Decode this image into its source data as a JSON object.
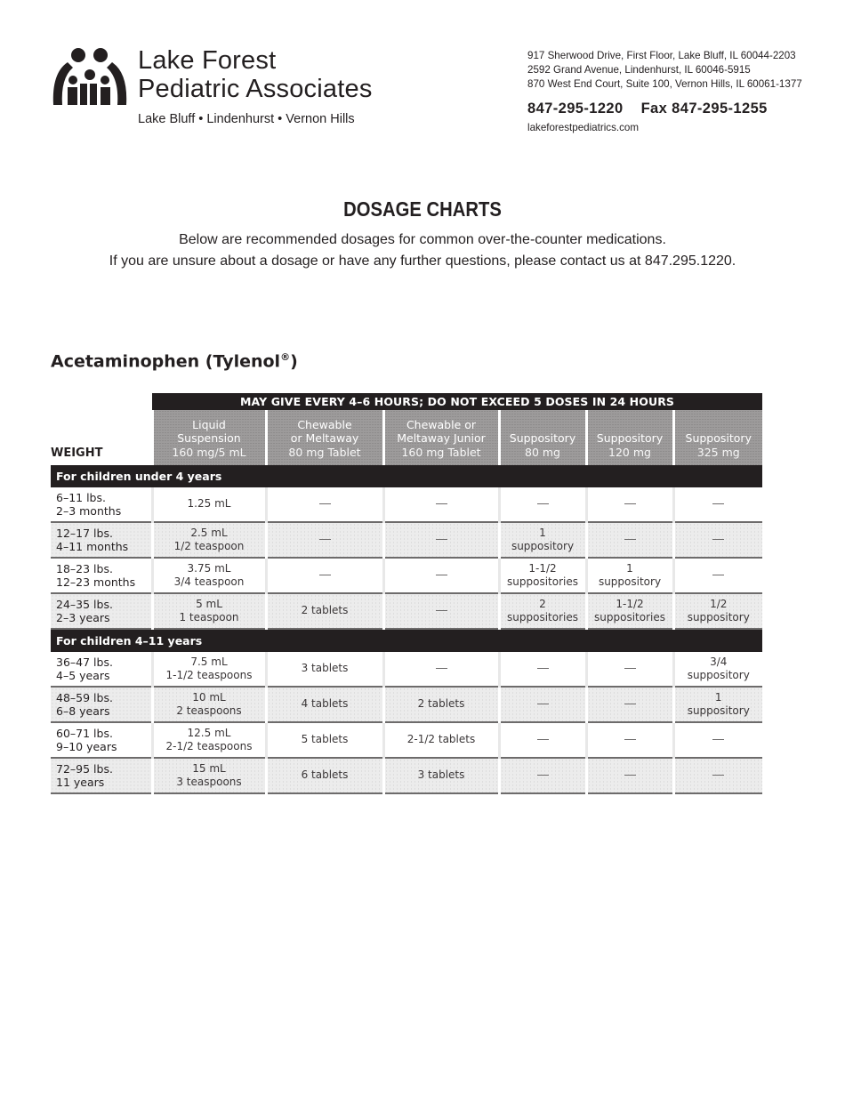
{
  "header": {
    "practice_name_line1": "Lake Forest",
    "practice_name_line2": "Pediatric Associates",
    "locations": "Lake Bluff • Lindenhurst • Vernon Hills",
    "addresses": [
      "917 Sherwood Drive, First Floor, Lake Bluff, IL 60044-2203",
      "2592 Grand Avenue, Lindenhurst, IL 60046-5915",
      "870 West End Court, Suite 100, Vernon Hills, IL 60061-1377"
    ],
    "phone": "847-295-1220",
    "fax": "Fax 847-295-1255",
    "website": "lakeforestpediatrics.com",
    "logo_icon": "family-logo-icon"
  },
  "page": {
    "title": "DOSAGE CHARTS",
    "intro_line1": "Below are recommended dosages for common over-the-counter medications.",
    "intro_line2": "If you are unsure about a dosage or have any further questions, please contact us at 847.295.1220."
  },
  "section": {
    "title": "Acetaminophen (Tylenol",
    "title_reg": "®",
    "title_close": ")"
  },
  "table": {
    "banner": "MAY GIVE EVERY 4–6 HOURS; DO NOT EXCEED 5 DOSES IN 24 HOURS",
    "weight_header": "WEIGHT",
    "columns": [
      {
        "line1": "Liquid",
        "line2": "Suspension",
        "line3": "160 mg/5 mL"
      },
      {
        "line1": "Chewable",
        "line2": "or Meltaway",
        "line3": "80 mg Tablet"
      },
      {
        "line1": "Chewable or",
        "line2": "Meltaway Junior",
        "line3": "160 mg Tablet"
      },
      {
        "line1": "",
        "line2": "Suppository",
        "line3": "80 mg"
      },
      {
        "line1": "",
        "line2": "Suppository",
        "line3": "120 mg"
      },
      {
        "line1": "",
        "line2": "Suppository",
        "line3": "325 mg"
      }
    ],
    "groups": [
      {
        "label": "For children under 4 years",
        "rows": [
          {
            "weight": "6–11 lbs.",
            "age": "2–3 months",
            "cells": [
              [
                "1.25 mL"
              ],
              [
                "—"
              ],
              [
                "—"
              ],
              [
                "—"
              ],
              [
                "—"
              ],
              [
                "—"
              ]
            ]
          },
          {
            "weight": "12–17 lbs.",
            "age": "4–11 months",
            "cells": [
              [
                "2.5 mL",
                "1/2 teaspoon"
              ],
              [
                "—"
              ],
              [
                "—"
              ],
              [
                "1",
                "suppository"
              ],
              [
                "—"
              ],
              [
                "—"
              ]
            ]
          },
          {
            "weight": "18–23 lbs.",
            "age": "12–23 months",
            "cells": [
              [
                "3.75 mL",
                "3/4 teaspoon"
              ],
              [
                "—"
              ],
              [
                "—"
              ],
              [
                "1-1/2",
                "suppositories"
              ],
              [
                "1",
                "suppository"
              ],
              [
                "—"
              ]
            ]
          },
          {
            "weight": "24–35 lbs.",
            "age": "2–3 years",
            "cells": [
              [
                "5 mL",
                "1 teaspoon"
              ],
              [
                "2 tablets"
              ],
              [
                "—"
              ],
              [
                "2",
                "suppositories"
              ],
              [
                "1-1/2",
                "suppositories"
              ],
              [
                "1/2",
                "suppository"
              ]
            ]
          }
        ]
      },
      {
        "label": "For children 4–11 years",
        "rows": [
          {
            "weight": "36–47 lbs.",
            "age": "4–5 years",
            "cells": [
              [
                "7.5 mL",
                "1-1/2 teaspoons"
              ],
              [
                "3 tablets"
              ],
              [
                "—"
              ],
              [
                "—"
              ],
              [
                "—"
              ],
              [
                "3/4",
                "suppository"
              ]
            ]
          },
          {
            "weight": "48–59 lbs.",
            "age": "6–8 years",
            "cells": [
              [
                "10 mL",
                "2 teaspoons"
              ],
              [
                "4 tablets"
              ],
              [
                "2 tablets"
              ],
              [
                "—"
              ],
              [
                "—"
              ],
              [
                "1",
                "suppository"
              ]
            ]
          },
          {
            "weight": "60–71 lbs.",
            "age": "9–10 years",
            "cells": [
              [
                "12.5 mL",
                "2-1/2 teaspoons"
              ],
              [
                "5 tablets"
              ],
              [
                "2-1/2 tablets"
              ],
              [
                "—"
              ],
              [
                "—"
              ],
              [
                "—"
              ]
            ]
          },
          {
            "weight": "72–95 lbs.",
            "age": "11 years",
            "cells": [
              [
                "15 mL",
                "3 teaspoons"
              ],
              [
                "6 tablets"
              ],
              [
                "3 tablets"
              ],
              [
                "—"
              ],
              [
                "—"
              ],
              [
                "—"
              ]
            ]
          }
        ]
      }
    ]
  }
}
